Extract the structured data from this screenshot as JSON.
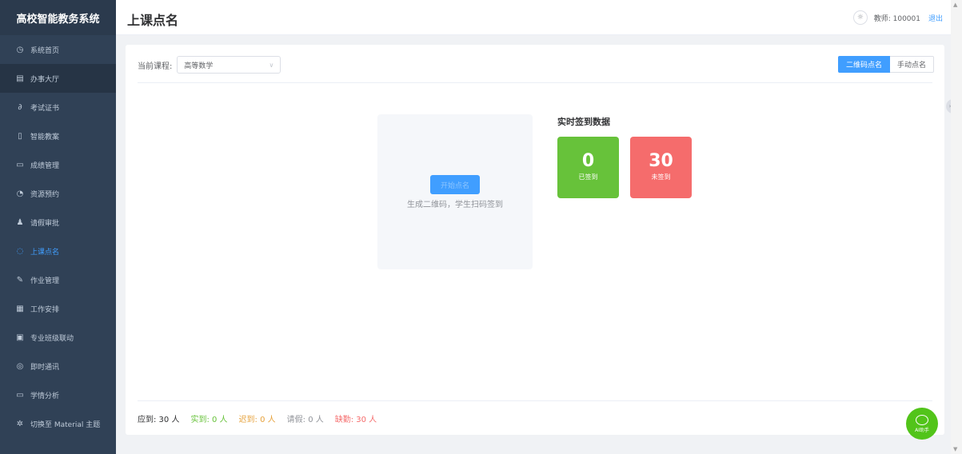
{
  "app": {
    "title": "高校智能教务系统"
  },
  "sidebar": {
    "items": [
      {
        "label": "系统首页",
        "icon": "dashboard-icon",
        "glyph": "◷"
      },
      {
        "label": "办事大厅",
        "icon": "building-icon",
        "glyph": "▤"
      },
      {
        "label": "考试证书",
        "icon": "link-icon",
        "glyph": "∂"
      },
      {
        "label": "智能教案",
        "icon": "document-icon",
        "glyph": "▯"
      },
      {
        "label": "成绩管理",
        "icon": "chart-icon",
        "glyph": "▭"
      },
      {
        "label": "资源预约",
        "icon": "clock-icon",
        "glyph": "◔"
      },
      {
        "label": "请假审批",
        "icon": "user-icon",
        "glyph": "♟"
      },
      {
        "label": "上课点名",
        "icon": "check-icon",
        "glyph": "◌"
      },
      {
        "label": "作业管理",
        "icon": "edit-icon",
        "glyph": "✎"
      },
      {
        "label": "工作安排",
        "icon": "calendar-icon",
        "glyph": "▦"
      },
      {
        "label": "专业班级联动",
        "icon": "board-icon",
        "glyph": "▣"
      },
      {
        "label": "即时通讯",
        "icon": "chat-icon",
        "glyph": "◎"
      },
      {
        "label": "学情分析",
        "icon": "analytics-icon",
        "glyph": "▭"
      },
      {
        "label": "切换至 Material 主题",
        "icon": "theme-icon",
        "glyph": "✲"
      }
    ]
  },
  "header": {
    "title": "上课点名",
    "user": "教师: 100001",
    "logout": "退出"
  },
  "main": {
    "course_label": "当前课程:",
    "course_value": "高等数学",
    "mode_qr": "二维码点名",
    "mode_manual": "手动点名",
    "qr_button": "开始点名",
    "qr_hint": "生成二维码，学生扫码签到",
    "stats_title": "实时签到数据",
    "signed_count": "0",
    "signed_label": "已签到",
    "unsigned_count": "30",
    "unsigned_label": "未签到",
    "summary": {
      "expected": "应到: 30 人",
      "actual": "实到: 0 人",
      "late": "迟到: 0 人",
      "leave": "请假: 0 人",
      "absent": "缺勤: 30 人"
    }
  },
  "ai_assistant": {
    "label": "AI助手"
  },
  "colors": {
    "accent": "#409eff",
    "success": "#67c23a",
    "danger": "#f56c6c",
    "sidebar": "#304156"
  }
}
